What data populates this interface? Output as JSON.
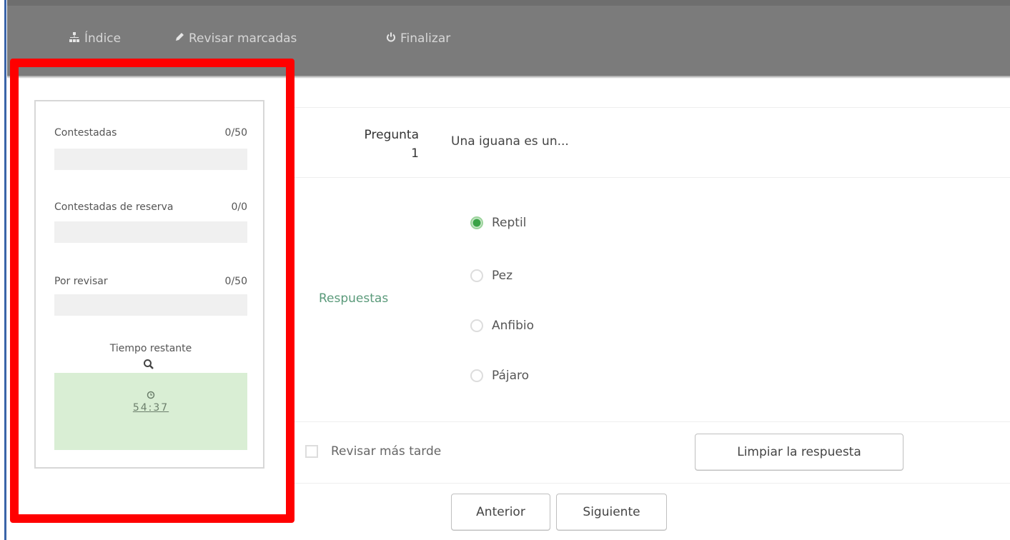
{
  "nav": {
    "items": [
      {
        "label": "Índice",
        "icon": "sitemap-icon"
      },
      {
        "label": "Revisar marcadas",
        "icon": "pencil-icon"
      },
      {
        "label": "Finalizar",
        "icon": "power-icon"
      }
    ]
  },
  "stats": {
    "answered": {
      "label": "Contestadas",
      "value": "0/50"
    },
    "reserve": {
      "label": "Contestadas de reserva",
      "value": "0/0"
    },
    "to_review": {
      "label": "Por revisar",
      "value": "0/50"
    },
    "timer": {
      "label": "Tiempo restante",
      "time": "54:37"
    }
  },
  "question": {
    "label": "Pregunta",
    "number": "1",
    "text": "Una iguana es un...",
    "answers_label": "Respuestas",
    "options": [
      {
        "label": "Reptil",
        "selected": true
      },
      {
        "label": "Pez",
        "selected": false
      },
      {
        "label": "Anfibio",
        "selected": false
      },
      {
        "label": "Pájaro",
        "selected": false
      }
    ]
  },
  "actions": {
    "review_later": "Revisar más tarde",
    "clear": "Limpiar la respuesta",
    "previous": "Anterior",
    "next": "Siguiente"
  },
  "colors": {
    "highlight": "#ff0000",
    "topbar": "#7b7b7b",
    "timer_bg": "#d9eed4",
    "selected_radio": "#3aa346"
  }
}
